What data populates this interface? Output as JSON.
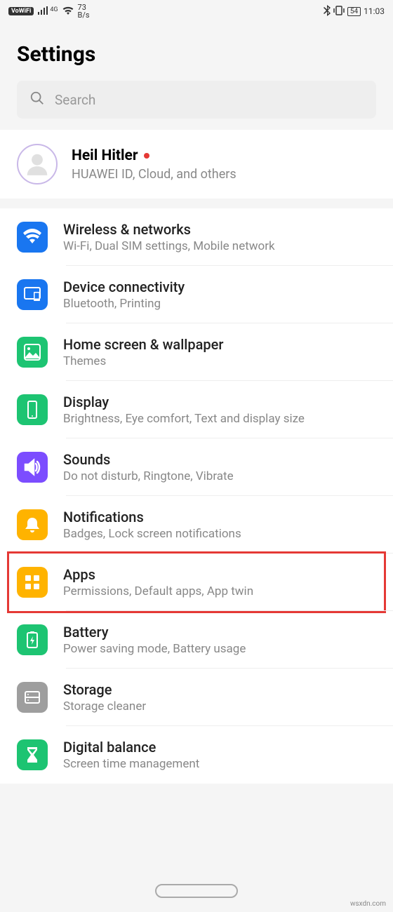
{
  "status": {
    "vowifi": "VoWiFi",
    "signal": "4G",
    "speed_value": "73",
    "speed_unit": "B/s",
    "battery": "54",
    "time": "11:03"
  },
  "page_title": "Settings",
  "search": {
    "placeholder": "Search"
  },
  "profile": {
    "name": "Heil Hitler",
    "sub": "HUAWEI ID, Cloud, and others"
  },
  "items": [
    {
      "title": "Wireless & networks",
      "sub": "Wi-Fi, Dual SIM settings, Mobile network",
      "icon": "wifi",
      "color": "ic-blue"
    },
    {
      "title": "Device connectivity",
      "sub": "Bluetooth, Printing",
      "icon": "devices",
      "color": "ic-blue"
    },
    {
      "title": "Home screen & wallpaper",
      "sub": "Themes",
      "icon": "image",
      "color": "ic-green"
    },
    {
      "title": "Display",
      "sub": "Brightness, Eye comfort, Text and display size",
      "icon": "phone",
      "color": "ic-green"
    },
    {
      "title": "Sounds",
      "sub": "Do not disturb, Ringtone, Vibrate",
      "icon": "sound",
      "color": "ic-purple"
    },
    {
      "title": "Notifications",
      "sub": "Badges, Lock screen notifications",
      "icon": "bell",
      "color": "ic-amber"
    },
    {
      "title": "Apps",
      "sub": "Permissions, Default apps, App twin",
      "icon": "grid",
      "color": "ic-amber",
      "highlight": true
    },
    {
      "title": "Battery",
      "sub": "Power saving mode, Battery usage",
      "icon": "battery",
      "color": "ic-green"
    },
    {
      "title": "Storage",
      "sub": "Storage cleaner",
      "icon": "storage",
      "color": "ic-gray"
    },
    {
      "title": "Digital balance",
      "sub": "Screen time management",
      "icon": "hourglass",
      "color": "ic-green"
    }
  ],
  "watermark": "wsxdn.com"
}
